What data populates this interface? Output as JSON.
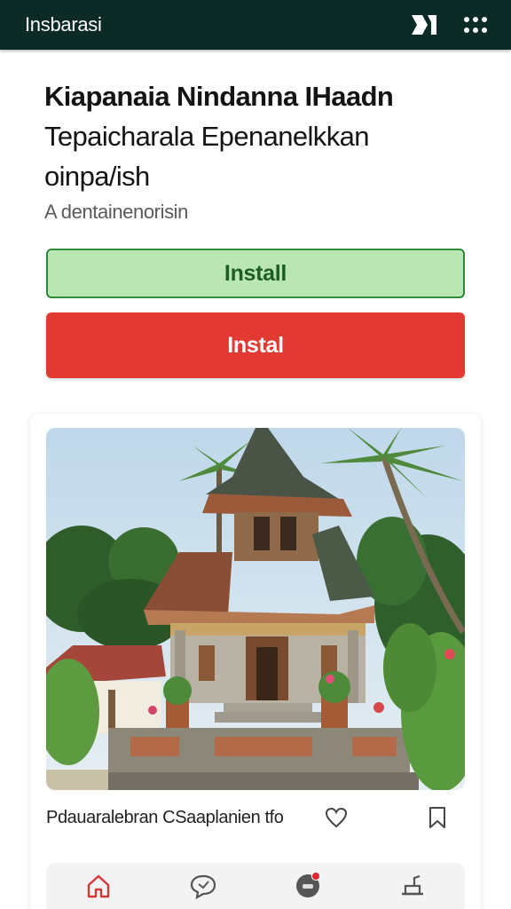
{
  "appbar": {
    "title": "Insbarasi",
    "icons": [
      "logo-mark-icon",
      "grid-dots-icon"
    ]
  },
  "article": {
    "headline_line1": "Kiapanaia Nindanna IHaadn",
    "headline_line2": "Tepaicharala Epenanelkkan",
    "headline_line3": "oinpa/ish",
    "subhead": "A dentainenorisin"
  },
  "buttons": {
    "install_label": "Install",
    "instal_label": "Instal"
  },
  "card": {
    "caption": "Pdauaralebran CSaaplanien tfo",
    "photo_subject": "balinese-temple-photo"
  },
  "bottom_nav": {
    "items": [
      "home-icon",
      "chat-icon",
      "notifications-icon",
      "settings-icon"
    ]
  },
  "colors": {
    "appbar": "#0c2a26",
    "install_bg": "#b9e6b2",
    "install_border": "#2f8a39",
    "instal_bg": "#e23a33",
    "home_icon": "#d13a36",
    "badge": "#e0262b"
  }
}
